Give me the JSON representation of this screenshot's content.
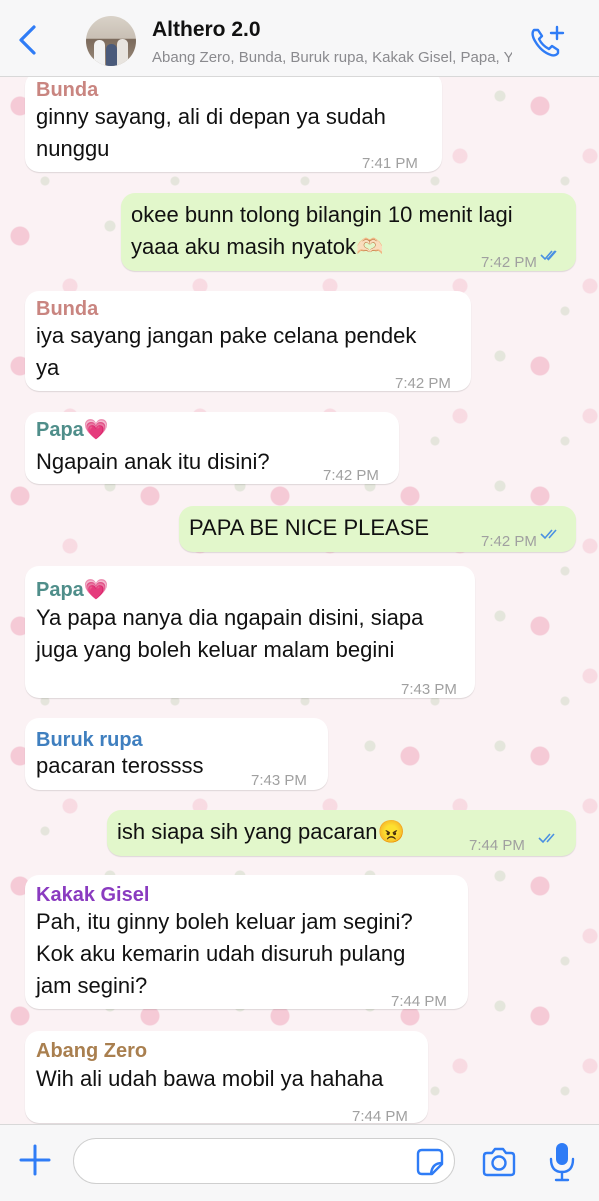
{
  "header": {
    "title": "Althero 2.0",
    "subtitle": "Abang Zero, Bunda, Buruk rupa, Kakak Gisel, Papa, You"
  },
  "colors": {
    "accent": "#2f7cf6",
    "bunda": "#c98580",
    "papa": "#4f8e8a",
    "buruk_rupa": "#3f7fbf",
    "kakak_gisel": "#8a3bc0",
    "abang_zero": "#a97f4f",
    "outgoing_bubble": "#e2f7cb",
    "incoming_bubble": "#ffffff"
  },
  "messages": [
    {
      "direction": "in",
      "sender": "Bunda",
      "lines": [
        "ginny sayang, ali di depan ya sudah",
        "nunggu"
      ],
      "time": "7:41 PM"
    },
    {
      "direction": "out",
      "lines": [
        "okee bunn tolong bilangin 10 menit lagi",
        "yaaa aku masih nyatok🫶🏻"
      ],
      "time": "7:42 PM",
      "status": "read"
    },
    {
      "direction": "in",
      "sender": "Bunda",
      "lines": [
        "iya sayang jangan pake celana pendek",
        "ya"
      ],
      "time": "7:42 PM"
    },
    {
      "direction": "in",
      "sender": "Papa💗",
      "lines": [
        "Ngapain anak itu disini?"
      ],
      "time": "7:42 PM"
    },
    {
      "direction": "out",
      "lines": [
        "PAPA BE NICE PLEASE"
      ],
      "time": "7:42 PM",
      "status": "read"
    },
    {
      "direction": "in",
      "sender": "Papa💗",
      "lines": [
        "Ya papa nanya dia ngapain disini, siapa",
        "juga yang boleh keluar malam begini"
      ],
      "time": "7:43 PM"
    },
    {
      "direction": "in",
      "sender": "Buruk rupa",
      "lines": [
        "pacaran terossss"
      ],
      "time": "7:43 PM"
    },
    {
      "direction": "out",
      "lines": [
        "ish siapa sih yang pacaran😠"
      ],
      "time": "7:44 PM",
      "status": "read"
    },
    {
      "direction": "in",
      "sender": "Kakak Gisel",
      "lines": [
        "Pah, itu ginny boleh keluar jam segini?",
        "Kok aku kemarin udah disuruh pulang",
        "jam segini?"
      ],
      "time": "7:44 PM"
    },
    {
      "direction": "in",
      "sender": "Abang Zero",
      "lines": [
        "Wih ali udah bawa mobil ya hahaha"
      ],
      "time": "7:44 PM"
    }
  ],
  "composer": {
    "value": "",
    "icons": [
      "plus-icon",
      "sticker-icon",
      "camera-icon",
      "microphone-icon"
    ]
  }
}
